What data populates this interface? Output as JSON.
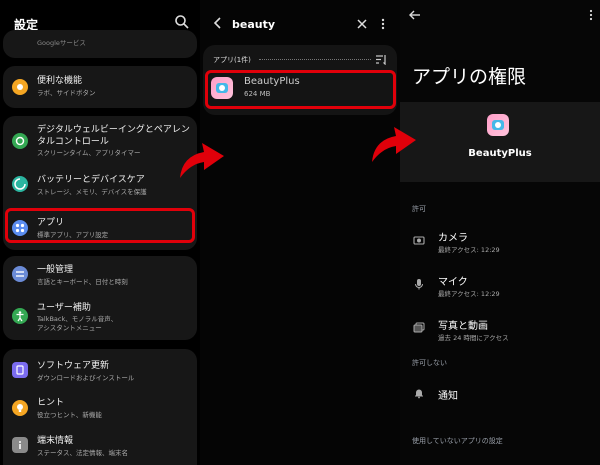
{
  "settings": {
    "title": "設定",
    "top_partial": "Googleサービス",
    "items": [
      {
        "title": "便利な機能",
        "subtitle": "ラボ、サイドボタン",
        "color": "#f5a623"
      },
      {
        "title": "デジタルウェルビーイングとペアレン",
        "title2": "タルコントロール",
        "subtitle": "スクリーンタイム、アプリタイマー",
        "color": "#34a853"
      },
      {
        "title": "バッテリーとデバイスケア",
        "subtitle": "ストレージ、メモリ、デバイスを保護",
        "color": "#2bb5a0"
      },
      {
        "title": "アプリ",
        "subtitle": "標準アプリ、アプリ設定",
        "color": "#5b8def"
      },
      {
        "title": "一般管理",
        "subtitle": "言語とキーボード、日付と時刻",
        "color": "#6b8bd6"
      },
      {
        "title": "ユーザー補助",
        "subtitle": "TalkBack、モノラル音声、",
        "subtitle2": "アシスタントメニュー",
        "color": "#34a853"
      },
      {
        "title": "ソフトウェア更新",
        "subtitle": "ダウンロードおよびインストール",
        "color": "#7b6cf0"
      },
      {
        "title": "ヒント",
        "subtitle": "役立つヒント、新機能",
        "color": "#f5a623"
      },
      {
        "title": "端末情報",
        "subtitle": "ステータス、法定情報、端末名",
        "color": "#8a8a8a"
      }
    ]
  },
  "search": {
    "query": "beauty",
    "section_label": "アプリ(1件)",
    "result": {
      "name": "BeautyPlus",
      "size": "624 MB"
    }
  },
  "permissions": {
    "title": "アプリの権限",
    "app_name": "BeautyPlus",
    "allowed_label": "許可",
    "allowed": [
      {
        "title": "カメラ",
        "subtitle": "最終アクセス: 12:29"
      },
      {
        "title": "マイク",
        "subtitle": "最終アクセス: 12:29"
      },
      {
        "title": "写真と動画",
        "subtitle": "過去 24 時間にアクセス"
      }
    ],
    "not_allowed_label": "許可しない",
    "not_allowed": [
      {
        "title": "通知"
      }
    ],
    "unused_label": "使用していないアプリの設定"
  },
  "colors": {
    "highlight": "#e0000a",
    "arrow": "#e0000a"
  }
}
